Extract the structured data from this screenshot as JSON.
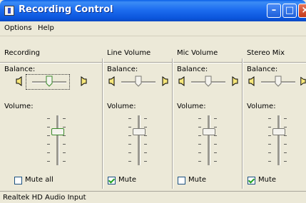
{
  "window": {
    "title": "Recording Control"
  },
  "menu": [
    {
      "label": "Options"
    },
    {
      "label": "Help"
    }
  ],
  "columns": [
    {
      "title": "Recording",
      "balance_label": "Balance:",
      "volume_label": "Volume:",
      "mute_label": "Mute all",
      "mute_checked": false,
      "balance": 0.5,
      "volume": 0.65
    },
    {
      "title": "Line Volume",
      "balance_label": "Balance:",
      "volume_label": "Volume:",
      "mute_label": "Mute",
      "mute_checked": true,
      "balance": 0.5,
      "volume": 0.65
    },
    {
      "title": "Mic Volume",
      "balance_label": "Balance:",
      "volume_label": "Volume:",
      "mute_label": "Mute",
      "mute_checked": false,
      "balance": 0.5,
      "volume": 0.65
    },
    {
      "title": "Stereo Mix",
      "balance_label": "Balance:",
      "volume_label": "Volume:",
      "mute_label": "Mute",
      "mute_checked": true,
      "balance": 0.5,
      "volume": 0.65
    }
  ],
  "status": {
    "text": "Realtek HD Audio Input"
  },
  "colors": {
    "title_bar": "#1d6df0",
    "face": "#ece9d8",
    "check": "#21a121",
    "close_button": "#c2381a"
  },
  "icons": {
    "window": "mixer-icon",
    "speaker": "speaker-icon"
  }
}
